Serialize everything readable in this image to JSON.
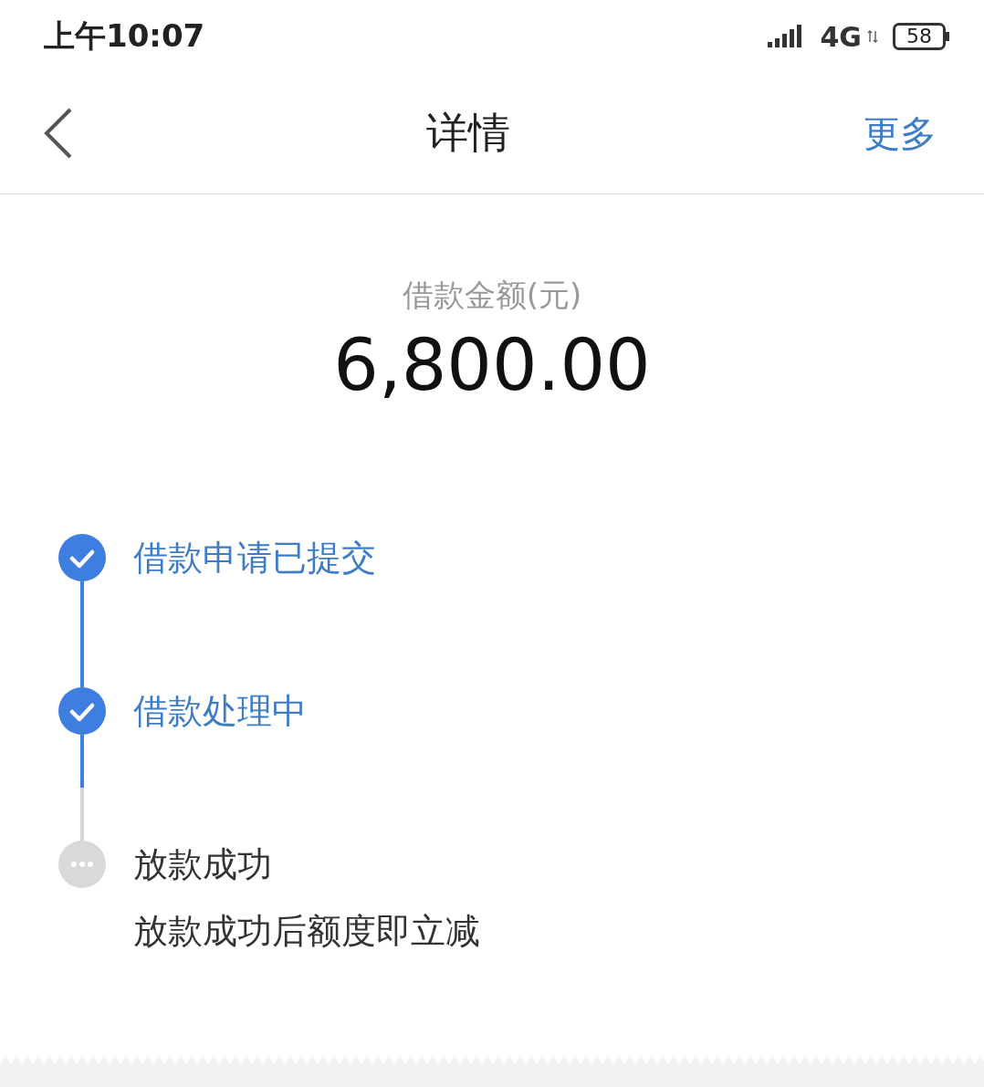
{
  "status_bar": {
    "time": "上午10:07",
    "network": "4G",
    "battery": "58"
  },
  "nav": {
    "title": "详情",
    "action": "更多"
  },
  "amount": {
    "label": "借款金额(元)",
    "value": "6,800.00"
  },
  "steps": [
    {
      "title": "借款申请已提交",
      "completed": true
    },
    {
      "title": "借款处理中",
      "completed": true
    },
    {
      "title": "放款成功",
      "completed": false,
      "note": "放款成功后额度即立减"
    }
  ]
}
